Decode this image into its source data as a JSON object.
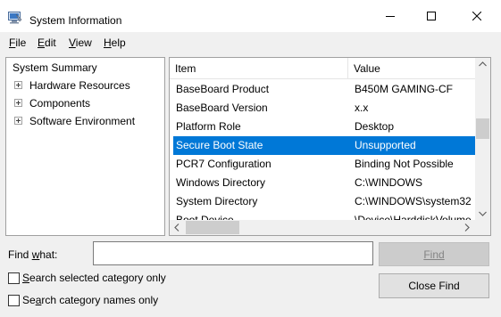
{
  "window": {
    "title": "System Information",
    "icon": "system-information-icon",
    "controls": {
      "minimize": "minimize-icon",
      "maximize": "maximize-icon",
      "close": "close-icon"
    }
  },
  "menu": [
    {
      "label": "File",
      "accel": "F",
      "rest": "ile"
    },
    {
      "label": "Edit",
      "accel": "E",
      "rest": "dit"
    },
    {
      "label": "View",
      "accel": "V",
      "rest": "iew"
    },
    {
      "label": "Help",
      "accel": "H",
      "rest": "elp"
    }
  ],
  "tree": {
    "root": "System Summary",
    "children": [
      "Hardware Resources",
      "Components",
      "Software Environment"
    ]
  },
  "list": {
    "columns": [
      "Item",
      "Value"
    ],
    "rows": [
      {
        "item": "BaseBoard Product",
        "value": "B450M GAMING-CF"
      },
      {
        "item": "BaseBoard Version",
        "value": "x.x"
      },
      {
        "item": "Platform Role",
        "value": "Desktop"
      },
      {
        "item": "Secure Boot State",
        "value": "Unsupported",
        "selected": true
      },
      {
        "item": "PCR7 Configuration",
        "value": "Binding Not Possible"
      },
      {
        "item": "Windows Directory",
        "value": "C:\\WINDOWS"
      },
      {
        "item": "System Directory",
        "value": "C:\\WINDOWS\\system32"
      },
      {
        "item": "Boot Device",
        "value": "\\Device\\HarddiskVolume"
      }
    ]
  },
  "find": {
    "label_accel_before": "Find ",
    "label_accel": "w",
    "label_accel_after": "hat:",
    "input_value": "",
    "find_button": "Find",
    "close_button": "Close Find",
    "search_selected_accel": "S",
    "search_selected_rest": "earch selected category only",
    "search_names_before": "Se",
    "search_names_accel": "a",
    "search_names_after": "rch category names only",
    "search_selected_checked": false,
    "search_names_checked": false
  },
  "colors": {
    "selection": "#0078d7",
    "window_bg": "#f0f0f0"
  }
}
